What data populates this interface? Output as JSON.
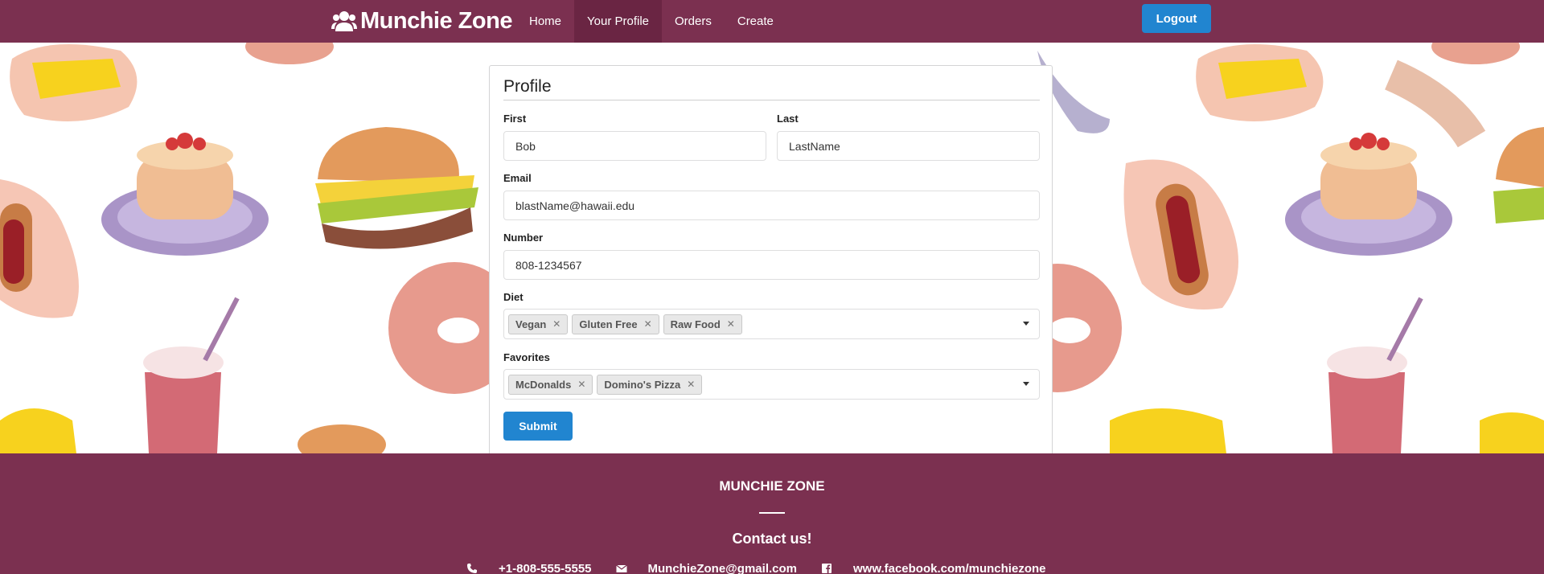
{
  "navbar": {
    "brand": "Munchie Zone",
    "items": [
      {
        "label": "Home",
        "active": false
      },
      {
        "label": "Your Profile",
        "active": true
      },
      {
        "label": "Orders",
        "active": false
      },
      {
        "label": "Create",
        "active": false
      }
    ],
    "logout": "Logout"
  },
  "profile": {
    "title": "Profile",
    "first_label": "First",
    "first_value": "Bob",
    "last_label": "Last",
    "last_value": "LastName",
    "email_label": "Email",
    "email_value": "blastName@hawaii.edu",
    "number_label": "Number",
    "number_value": "808-1234567",
    "diet_label": "Diet",
    "diet_tags": [
      "Vegan",
      "Gluten Free",
      "Raw Food"
    ],
    "favorites_label": "Favorites",
    "favorites_tags": [
      "McDonalds",
      "Domino's Pizza"
    ],
    "submit": "Submit"
  },
  "footer": {
    "title": "MUNCHIE ZONE",
    "contact_heading": "Contact us!",
    "phone": "+1-808-555-5555",
    "email": "MunchieZone@gmail.com",
    "facebook": "www.facebook.com/munchiezone"
  },
  "icons": {
    "brand": "users-icon",
    "phone": "phone-icon",
    "email": "envelope-icon",
    "facebook": "facebook-icon"
  },
  "colors": {
    "brand": "#7b3050",
    "primary_button": "#2185d0"
  }
}
